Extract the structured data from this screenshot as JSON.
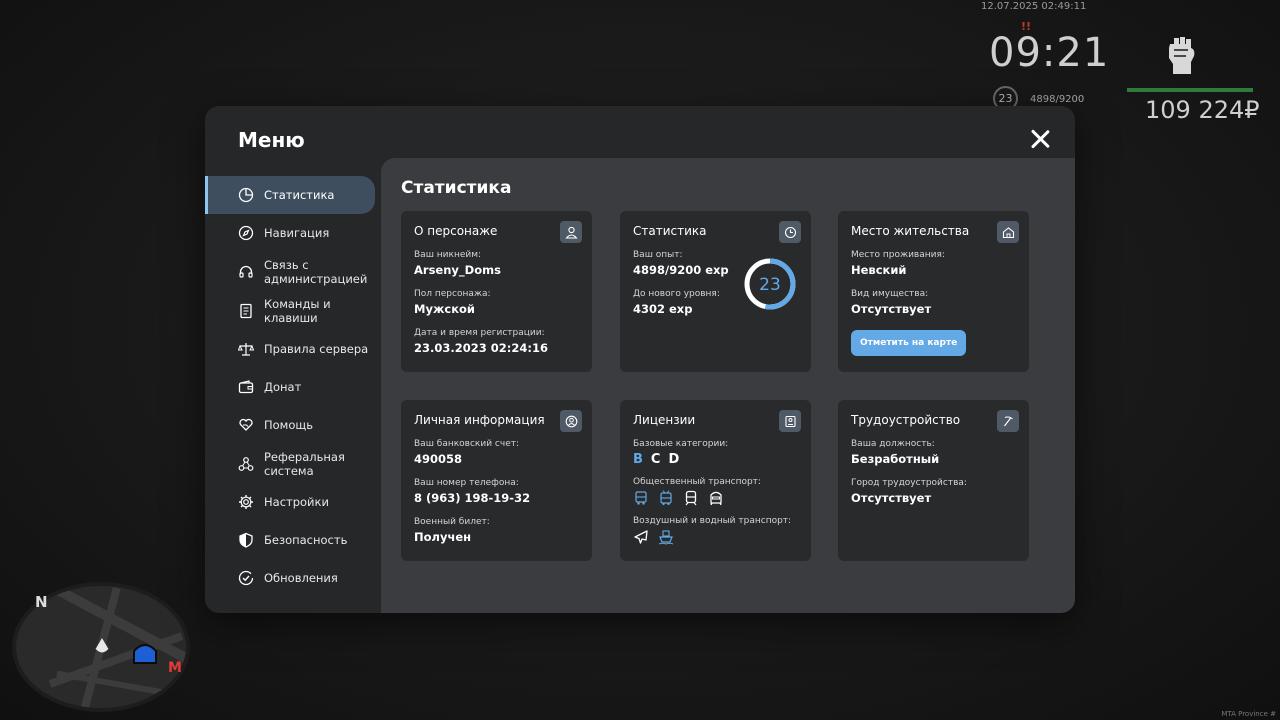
{
  "hud": {
    "datetime": "12.07.2025 02:49:11",
    "marker": "!!",
    "time": "09:21",
    "level": "23",
    "exp": "4898/9200",
    "money": "109 224₽",
    "watermark": "MTA Province #"
  },
  "minimap": {
    "north": "N",
    "metro": "M"
  },
  "menu": {
    "title": "Меню",
    "sidebar": [
      {
        "label": "Статистика",
        "icon": "pie-chart-icon",
        "active": true
      },
      {
        "label": "Навигация",
        "icon": "compass-icon"
      },
      {
        "label": "Связь с администрацией",
        "icon": "headset-icon"
      },
      {
        "label": "Команды и клавиши",
        "icon": "document-icon"
      },
      {
        "label": "Правила сервера",
        "icon": "scales-icon"
      },
      {
        "label": "Донат",
        "icon": "wallet-icon"
      },
      {
        "label": "Помощь",
        "icon": "heart-hand-icon"
      },
      {
        "label": "Реферальная система",
        "icon": "referral-icon"
      },
      {
        "label": "Настройки",
        "icon": "gear-icon"
      },
      {
        "label": "Безопасность",
        "icon": "shield-icon"
      },
      {
        "label": "Обновления",
        "icon": "check-circle-icon"
      }
    ],
    "content_title": "Статистика",
    "cards": {
      "character": {
        "title": "О персонаже",
        "nickname_label": "Ваш никнейм:",
        "nickname": "Arseny_Doms",
        "gender_label": "Пол персонажа:",
        "gender": "Мужской",
        "reg_label": "Дата и время регистрации:",
        "reg": "23.03.2023 02:24:16"
      },
      "stats": {
        "title": "Статистика",
        "exp_label": "Ваш опыт:",
        "exp": "4898/9200 exp",
        "next_label": "До нового уровня:",
        "next": "4302 exp",
        "level": "23",
        "progress": 0.532
      },
      "residence": {
        "title": "Место жительства",
        "place_label": "Место проживания:",
        "place": "Невский",
        "property_label": "Вид имущества:",
        "property": "Отсутствует",
        "map_button": "Отметить на карте"
      },
      "personal": {
        "title": "Личная информация",
        "bank_label": "Ваш банковский счет:",
        "bank": "490058",
        "phone_label": "Ваш номер телефона:",
        "phone": "8 (963) 198-19-32",
        "military_label": "Военный билет:",
        "military": "Получен"
      },
      "licenses": {
        "title": "Лицензии",
        "base_label": "Базовые категории:",
        "categories": [
          {
            "letter": "B",
            "color": "#63a9e6"
          },
          {
            "letter": "C",
            "color": "#ffffff"
          },
          {
            "letter": "D",
            "color": "#ffffff"
          }
        ],
        "public_label": "Общественный транспорт:",
        "air_label": "Воздушный и водный транспорт:"
      },
      "employment": {
        "title": "Трудоустройство",
        "position_label": "Ваша должность:",
        "position": "Безработный",
        "city_label": "Город трудоустройства:",
        "city": "Отсутствует"
      }
    }
  },
  "colors": {
    "accent": "#63a9e6",
    "active_nav": "#3f4e5f",
    "hp_bar": "#2f7a3c"
  }
}
